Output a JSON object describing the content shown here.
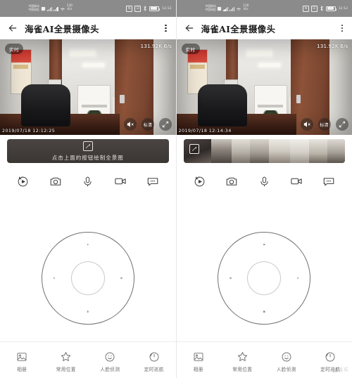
{
  "status_bar": {
    "carrier_line1": "中国移动",
    "carrier_line2": "中国电信",
    "network_speed_value": "130",
    "network_speed_unit": "K/s",
    "time": "12:12",
    "icons": [
      "sim-card-icon",
      "signal-bars-icon",
      "signal-bars-2-icon",
      "wifi-icon",
      "nfc-icon",
      "shield-icon",
      "bluetooth-icon",
      "battery-icon"
    ]
  },
  "header": {
    "back_icon": "back-arrow-icon",
    "title": "海雀AI全景摄像头",
    "menu_icon": "kebab-menu-icon"
  },
  "video": {
    "live_badge": "实时",
    "bitrate": "131.92K B/s",
    "timestamp_left": "2019/07/18 12:12:25",
    "timestamp_right": "2019/07/18 12:14:34",
    "controls": {
      "mute_icon": "speaker-muted-icon",
      "quality_label": "标清",
      "fullscreen_icon": "expand-arrows-icon"
    }
  },
  "panorama": {
    "hint_text": "点击上面的按钮绘制全景图",
    "draw_icon": "panorama-draw-icon"
  },
  "actions": [
    {
      "name": "playback",
      "icon": "playback-replay-icon"
    },
    {
      "name": "snapshot",
      "icon": "camera-icon"
    },
    {
      "name": "talk",
      "icon": "microphone-icon"
    },
    {
      "name": "record",
      "icon": "video-camera-icon"
    },
    {
      "name": "message",
      "icon": "message-bubble-icon"
    }
  ],
  "dpad": {
    "name": "pan-tilt-control",
    "directions": [
      "up",
      "right",
      "down",
      "left"
    ],
    "center": "center-button"
  },
  "tabs": [
    {
      "label": "相册",
      "icon": "photo-album-icon"
    },
    {
      "label": "常用位置",
      "icon": "star-icon"
    },
    {
      "label": "人脸侦测",
      "icon": "face-detect-icon"
    },
    {
      "label": "定时巡航",
      "icon": "timer-cruise-icon"
    }
  ],
  "watermark": "值得买",
  "colors": {
    "statusbar_bg": "#8b8b8b",
    "text_primary": "#1c1c1c",
    "icon_gray": "#6f6f73",
    "panorama_bg": "#3b3734"
  }
}
